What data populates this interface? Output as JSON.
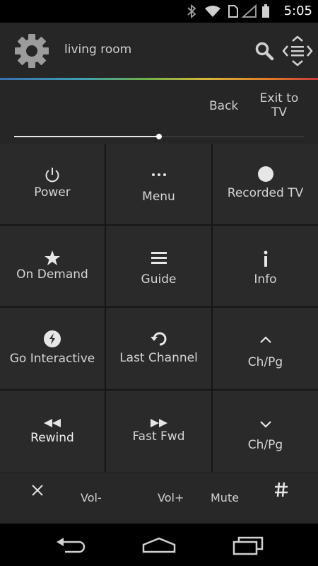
{
  "status": {
    "time": "5:05"
  },
  "header": {
    "room": "living room"
  },
  "subbar": {
    "back": "Back",
    "exit_line1": "Exit to",
    "exit_line2": "TV",
    "slider_fraction": 0.5
  },
  "grid": {
    "power": "Power",
    "menu": "Menu",
    "recorded_tv": "Recorded TV",
    "on_demand": "On Demand",
    "guide": "Guide",
    "info": "Info",
    "go_interactive": "Go Interactive",
    "last_channel": "Last Channel",
    "ch_up": "Ch/Pg",
    "rewind": "Rewind",
    "fast_fwd": "Fast Fwd",
    "ch_down": "Ch/Pg"
  },
  "bottom": {
    "vol_down": "Vol-",
    "vol_up": "Vol+",
    "mute": "Mute"
  },
  "colors": {
    "background": "#222222",
    "cell": "#2a2a2a",
    "text": "#d4d4d4"
  }
}
